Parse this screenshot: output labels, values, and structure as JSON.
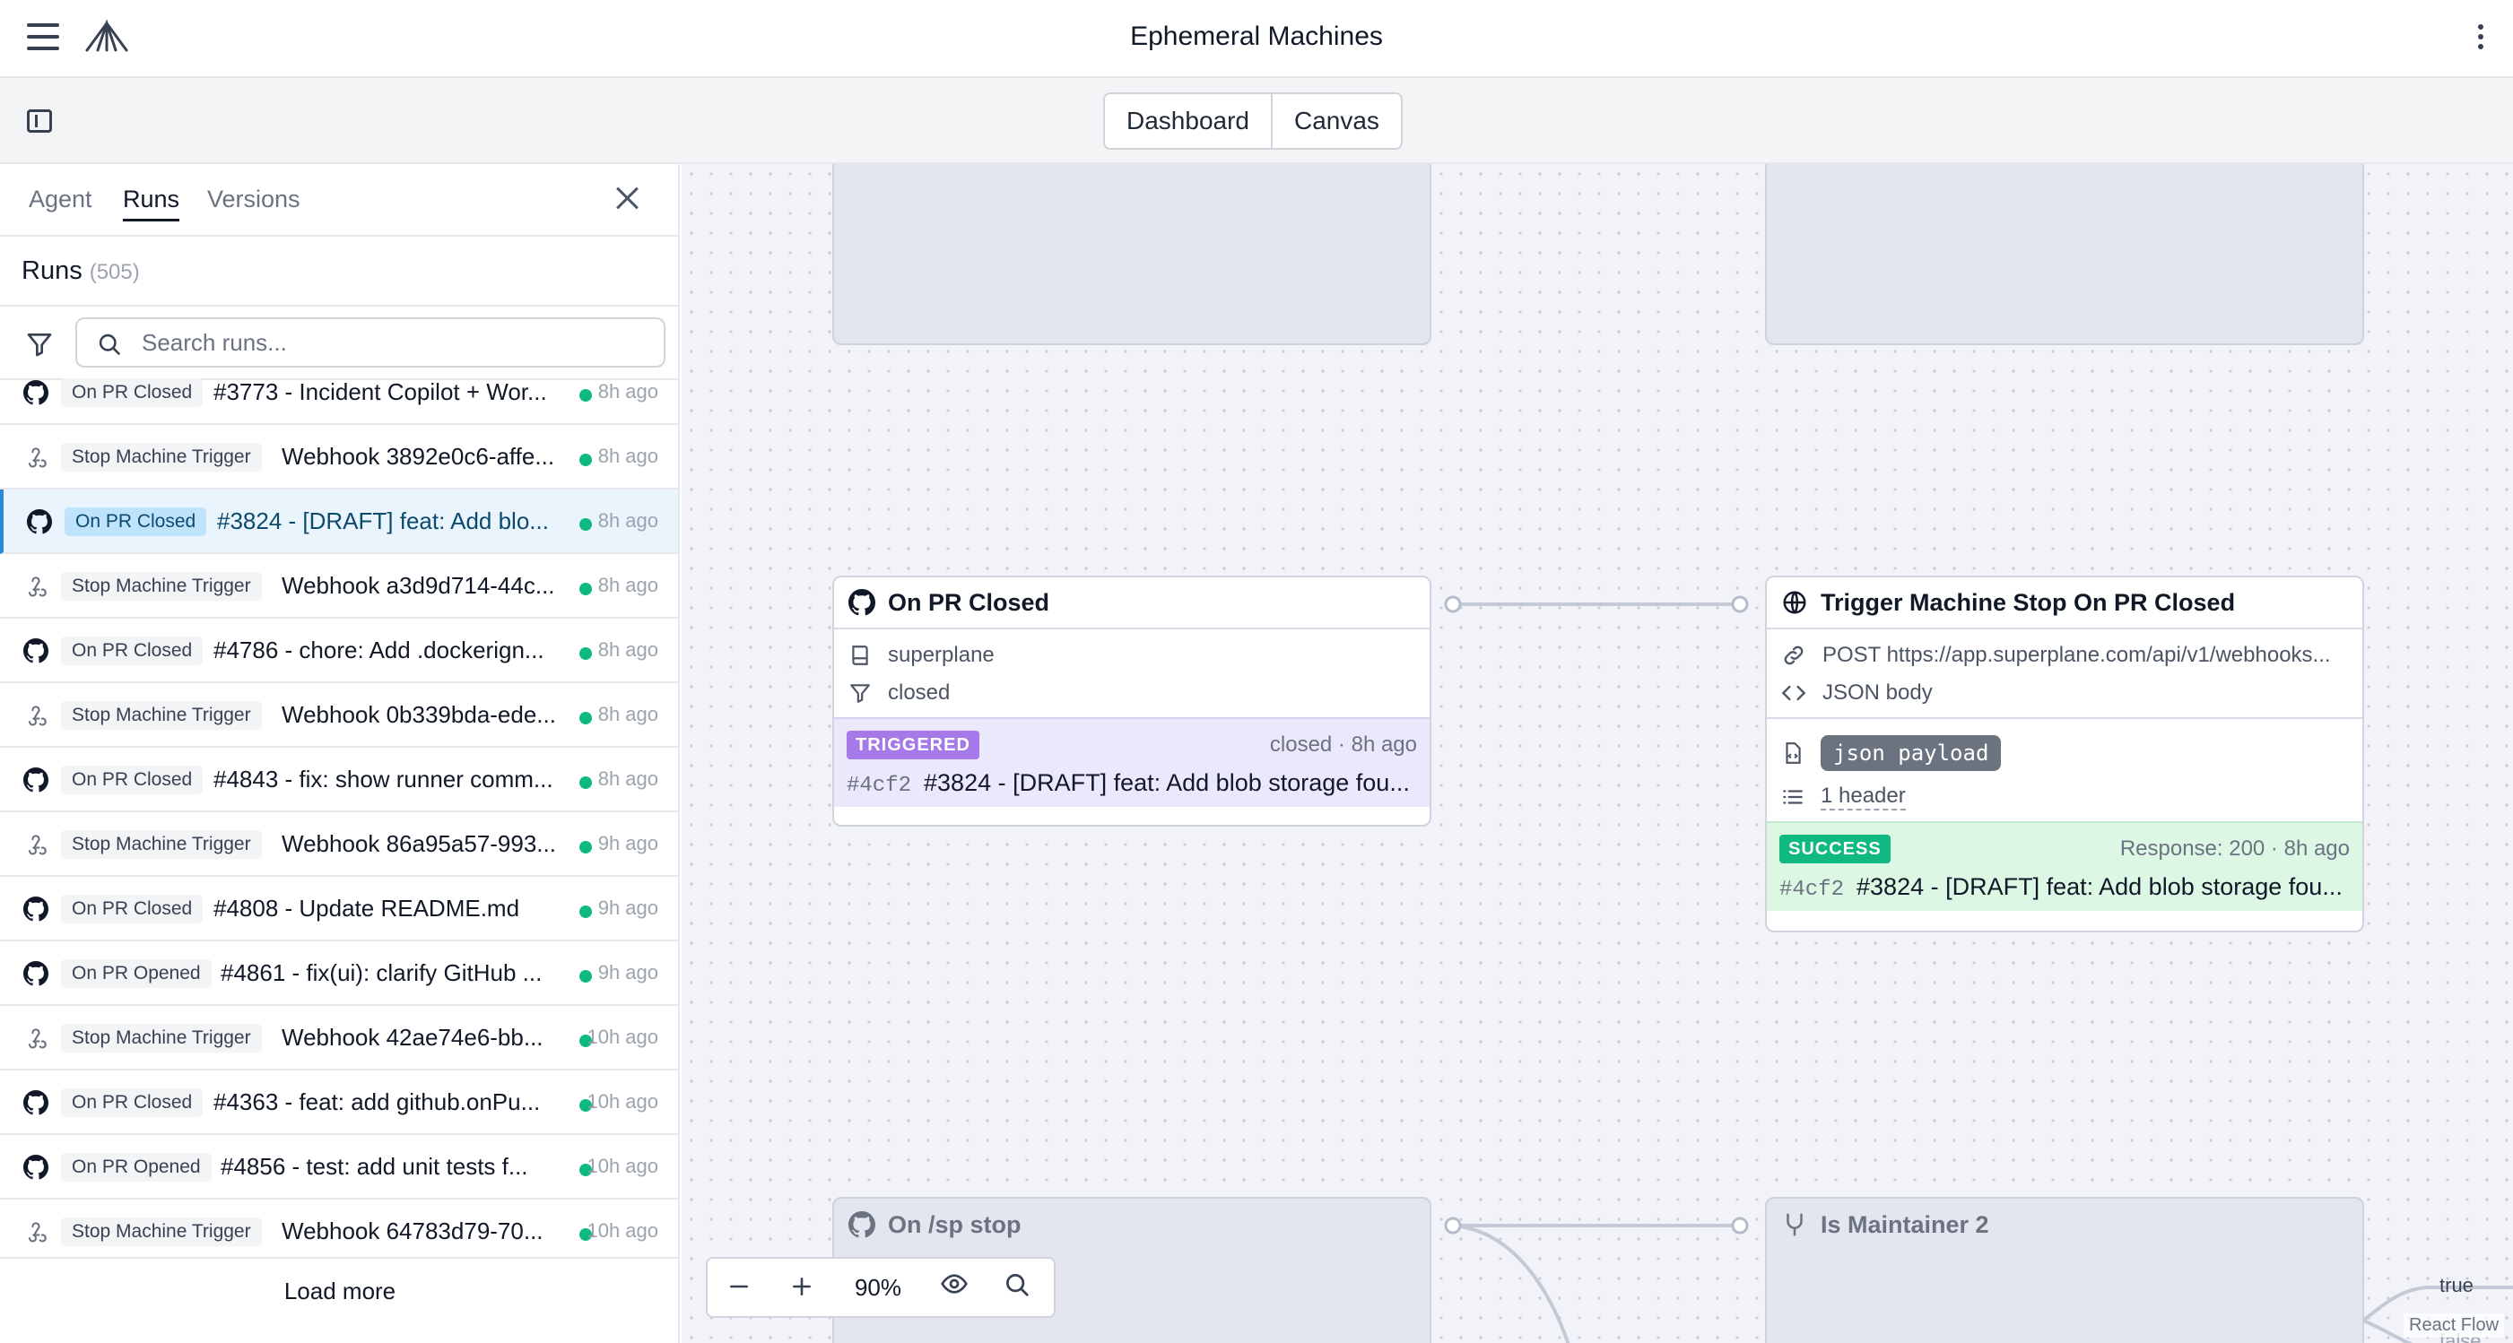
{
  "app": {
    "title": "Ephemeral Machines"
  },
  "views": {
    "dashboard": "Dashboard",
    "canvas": "Canvas"
  },
  "sidebar": {
    "tabs": {
      "agent": "Agent",
      "runs": "Runs",
      "versions": "Versions"
    },
    "runs_title": "Runs",
    "runs_count": "(505)",
    "search_placeholder": "Search runs...",
    "load_more": "Load more",
    "runs": [
      {
        "icon": "github-icon",
        "badge": "On PR Closed",
        "title": "#3773 - Incident Copilot + Wor...",
        "age": "8h ago"
      },
      {
        "icon": "webhook-icon",
        "badge": "Stop Machine Trigger",
        "title": "Webhook 3892e0c6-affe...",
        "age": "8h ago"
      },
      {
        "icon": "github-icon",
        "badge": "On PR Closed",
        "title": "#3824 - [DRAFT] feat: Add blo...",
        "age": "8h ago",
        "selected": true
      },
      {
        "icon": "webhook-icon",
        "badge": "Stop Machine Trigger",
        "title": "Webhook a3d9d714-44c...",
        "age": "8h ago"
      },
      {
        "icon": "github-icon",
        "badge": "On PR Closed",
        "title": "#4786 - chore: Add .dockerign...",
        "age": "8h ago"
      },
      {
        "icon": "webhook-icon",
        "badge": "Stop Machine Trigger",
        "title": "Webhook 0b339bda-ede...",
        "age": "8h ago"
      },
      {
        "icon": "github-icon",
        "badge": "On PR Closed",
        "title": "#4843 - fix: show runner comm...",
        "age": "8h ago"
      },
      {
        "icon": "webhook-icon",
        "badge": "Stop Machine Trigger",
        "title": "Webhook 86a95a57-993...",
        "age": "9h ago"
      },
      {
        "icon": "github-icon",
        "badge": "On PR Closed",
        "title": "#4808 - Update README.md",
        "age": "9h ago"
      },
      {
        "icon": "github-icon",
        "badge": "On PR Opened",
        "title": "#4861 - fix(ui): clarify GitHub ...",
        "age": "9h ago"
      },
      {
        "icon": "webhook-icon",
        "badge": "Stop Machine Trigger",
        "title": "Webhook 42ae74e6-bb...",
        "age": "10h ago"
      },
      {
        "icon": "github-icon",
        "badge": "On PR Closed",
        "title": "#4363 - feat: add github.onPu...",
        "age": "10h ago"
      },
      {
        "icon": "github-icon",
        "badge": "On PR Opened",
        "title": "#4856 - test: add unit tests f...",
        "age": "10h ago"
      },
      {
        "icon": "webhook-icon",
        "badge": "Stop Machine Trigger",
        "title": "Webhook 64783d79-70...",
        "age": "10h ago"
      }
    ]
  },
  "nodes": {
    "pr_closed": {
      "title": "On PR Closed",
      "repo": "superplane",
      "filter": "closed",
      "status": "TRIGGERED",
      "meta": "closed · 8h ago",
      "hash": "#4cf2",
      "run": "#3824 - [DRAFT] feat: Add blob storage fou..."
    },
    "stop_trigger": {
      "title": "Trigger Machine Stop On PR Closed",
      "url": "POST https://app.superplane.com/api/v1/webhooks...",
      "body": "JSON body",
      "payload": "json payload",
      "headers": "1 header",
      "status": "SUCCESS",
      "meta": "Response: 200 · 8h ago",
      "hash": "#4cf2",
      "run": "#3824 - [DRAFT] feat: Add blob storage fou..."
    },
    "sp_stop": {
      "title": "On /sp stop"
    },
    "maintainer": {
      "title": "Is Maintainer 2"
    }
  },
  "edges": {
    "true_label": "true",
    "false_label": "false"
  },
  "zoom": {
    "level": "90%"
  },
  "attribution": "React Flow",
  "colors": {
    "selected": "#2b89d6",
    "success": "#10b981",
    "triggered": "#a57ae8"
  }
}
